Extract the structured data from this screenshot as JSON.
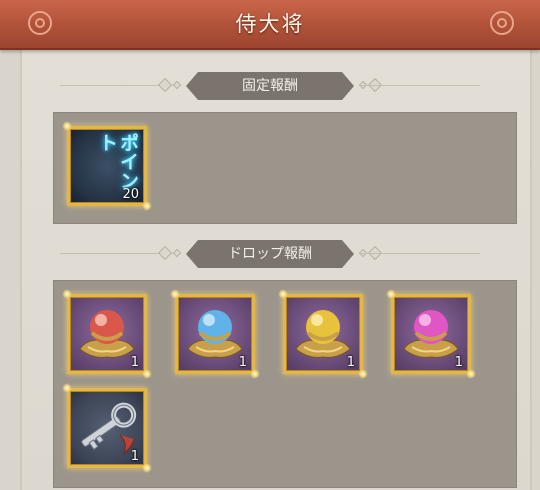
{
  "header": {
    "title": "侍大将"
  },
  "fixed_reward": {
    "label": "固定報酬",
    "items": [
      {
        "icon": "point-icon",
        "text": "ポイント",
        "count": "20"
      }
    ]
  },
  "drop_reward": {
    "label": "ドロップ報酬",
    "items": [
      {
        "icon": "red-orb-icon",
        "count": "1",
        "orb_color": "#d9584a"
      },
      {
        "icon": "blue-orb-icon",
        "count": "1",
        "orb_color": "#5fb3e6"
      },
      {
        "icon": "yellow-orb-icon",
        "count": "1",
        "orb_color": "#e9c23c"
      },
      {
        "icon": "pink-orb-icon",
        "count": "1",
        "orb_color": "#e056c3"
      },
      {
        "icon": "key-icon",
        "count": "1"
      }
    ]
  },
  "colors": {
    "title_bar": "#b4553b",
    "frame_gold": "#e3b64a",
    "section_label_bg": "#7b746c"
  }
}
